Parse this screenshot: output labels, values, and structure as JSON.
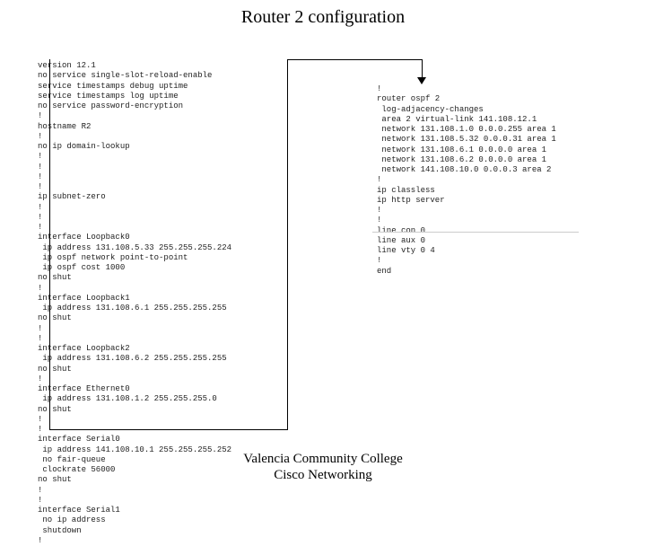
{
  "title": "Router 2 configuration",
  "footer_line1": "Valencia Community College",
  "footer_line2": "Cisco Networking",
  "config_left": "version 12.1\nno service single-slot-reload-enable\nservice timestamps debug uptime\nservice timestamps log uptime\nno service password-encryption\n!\nhostname R2\n!\nno ip domain-lookup\n!\n!\n!\n!\nip subnet-zero\n!\n!\n!\ninterface Loopback0\n ip address 131.108.5.33 255.255.255.224\n ip ospf network point-to-point\n ip ospf cost 1000\nno shut\n!\ninterface Loopback1\n ip address 131.108.6.1 255.255.255.255\nno shut\n!\n!\ninterface Loopback2\n ip address 131.108.6.2 255.255.255.255\nno shut\n!\ninterface Ethernet0\n ip address 131.108.1.2 255.255.255.0\nno shut\n!\n!\ninterface Serial0\n ip address 141.108.10.1 255.255.255.252\n no fair-queue\n clockrate 56000\nno shut\n!\n!\ninterface Serial1\n no ip address\n shutdown\n!",
  "config_right": "!\nrouter ospf 2\n log-adjacency-changes\n area 2 virtual-link 141.108.12.1\n network 131.108.1.0 0.0.0.255 area 1\n network 131.108.5.32 0.0.0.31 area 1\n network 131.108.6.1 0.0.0.0 area 1\n network 131.108.6.2 0.0.0.0 area 1\n network 141.108.10.0 0.0.0.3 area 2\n!\nip classless\nip http server\n!\n!\nline con 0\nline aux 0\nline vty 0 4\n!\nend"
}
